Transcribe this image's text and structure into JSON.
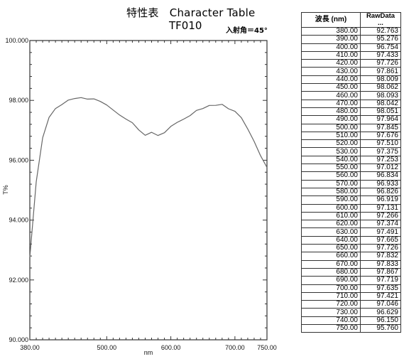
{
  "header": {
    "title": "特性表　Character Table",
    "subtitle": "TF010",
    "incidence_angle": "入射角＝45°"
  },
  "table": {
    "columns": [
      "波長 (nm)",
      "RawData ..."
    ],
    "rows": [
      [
        "380.00",
        "92.763"
      ],
      [
        "390.00",
        "95.276"
      ],
      [
        "400.00",
        "96.754"
      ],
      [
        "410.00",
        "97.433"
      ],
      [
        "420.00",
        "97.726"
      ],
      [
        "430.00",
        "97.861"
      ],
      [
        "440.00",
        "98.009"
      ],
      [
        "450.00",
        "98.062"
      ],
      [
        "460.00",
        "98.093"
      ],
      [
        "470.00",
        "98.042"
      ],
      [
        "480.00",
        "98.051"
      ],
      [
        "490.00",
        "97.964"
      ],
      [
        "500.00",
        "97.845"
      ],
      [
        "510.00",
        "97.676"
      ],
      [
        "520.00",
        "97.510"
      ],
      [
        "530.00",
        "97.375"
      ],
      [
        "540.00",
        "97.253"
      ],
      [
        "550.00",
        "97.012"
      ],
      [
        "560.00",
        "96.834"
      ],
      [
        "570.00",
        "96.933"
      ],
      [
        "580.00",
        "96.826"
      ],
      [
        "590.00",
        "96.919"
      ],
      [
        "600.00",
        "97.131"
      ],
      [
        "610.00",
        "97.266"
      ],
      [
        "620.00",
        "97.374"
      ],
      [
        "630.00",
        "97.491"
      ],
      [
        "640.00",
        "97.665"
      ],
      [
        "650.00",
        "97.726"
      ],
      [
        "660.00",
        "97.832"
      ],
      [
        "670.00",
        "97.833"
      ],
      [
        "680.00",
        "97.867"
      ],
      [
        "690.00",
        "97.719"
      ],
      [
        "700.00",
        "97.635"
      ],
      [
        "710.00",
        "97.421"
      ],
      [
        "720.00",
        "97.046"
      ],
      [
        "730.00",
        "96.629"
      ],
      [
        "740.00",
        "96.150"
      ],
      [
        "750.00",
        "95.760"
      ]
    ]
  },
  "chart_data": {
    "type": "line",
    "title": "Character Table",
    "xlabel": "nm",
    "ylabel": "T%",
    "xlim": [
      380,
      750
    ],
    "ylim": [
      90,
      100
    ],
    "x_ticks": [
      380,
      500,
      600,
      700,
      750
    ],
    "x_tick_labels": [
      "380.00",
      "500.00",
      "600.00",
      "700.00",
      "750.00"
    ],
    "y_ticks": [
      90,
      92,
      94,
      96,
      98,
      100
    ],
    "y_tick_labels": [
      "90.000",
      "92.000",
      "94.000",
      "96.000",
      "98.000",
      "100.000"
    ],
    "grid": false,
    "series": [
      {
        "name": "RawData",
        "color": "#666666",
        "x": [
          380,
          390,
          400,
          410,
          420,
          430,
          440,
          450,
          460,
          470,
          480,
          490,
          500,
          510,
          520,
          530,
          540,
          550,
          560,
          570,
          580,
          590,
          600,
          610,
          620,
          630,
          640,
          650,
          660,
          670,
          680,
          690,
          700,
          710,
          720,
          730,
          740,
          750
        ],
        "values": [
          92.763,
          95.276,
          96.754,
          97.433,
          97.726,
          97.861,
          98.009,
          98.062,
          98.093,
          98.042,
          98.051,
          97.964,
          97.845,
          97.676,
          97.51,
          97.375,
          97.253,
          97.012,
          96.834,
          96.933,
          96.826,
          96.919,
          97.131,
          97.266,
          97.374,
          97.491,
          97.665,
          97.726,
          97.832,
          97.833,
          97.867,
          97.719,
          97.635,
          97.421,
          97.046,
          96.629,
          96.15,
          95.76
        ]
      }
    ]
  }
}
